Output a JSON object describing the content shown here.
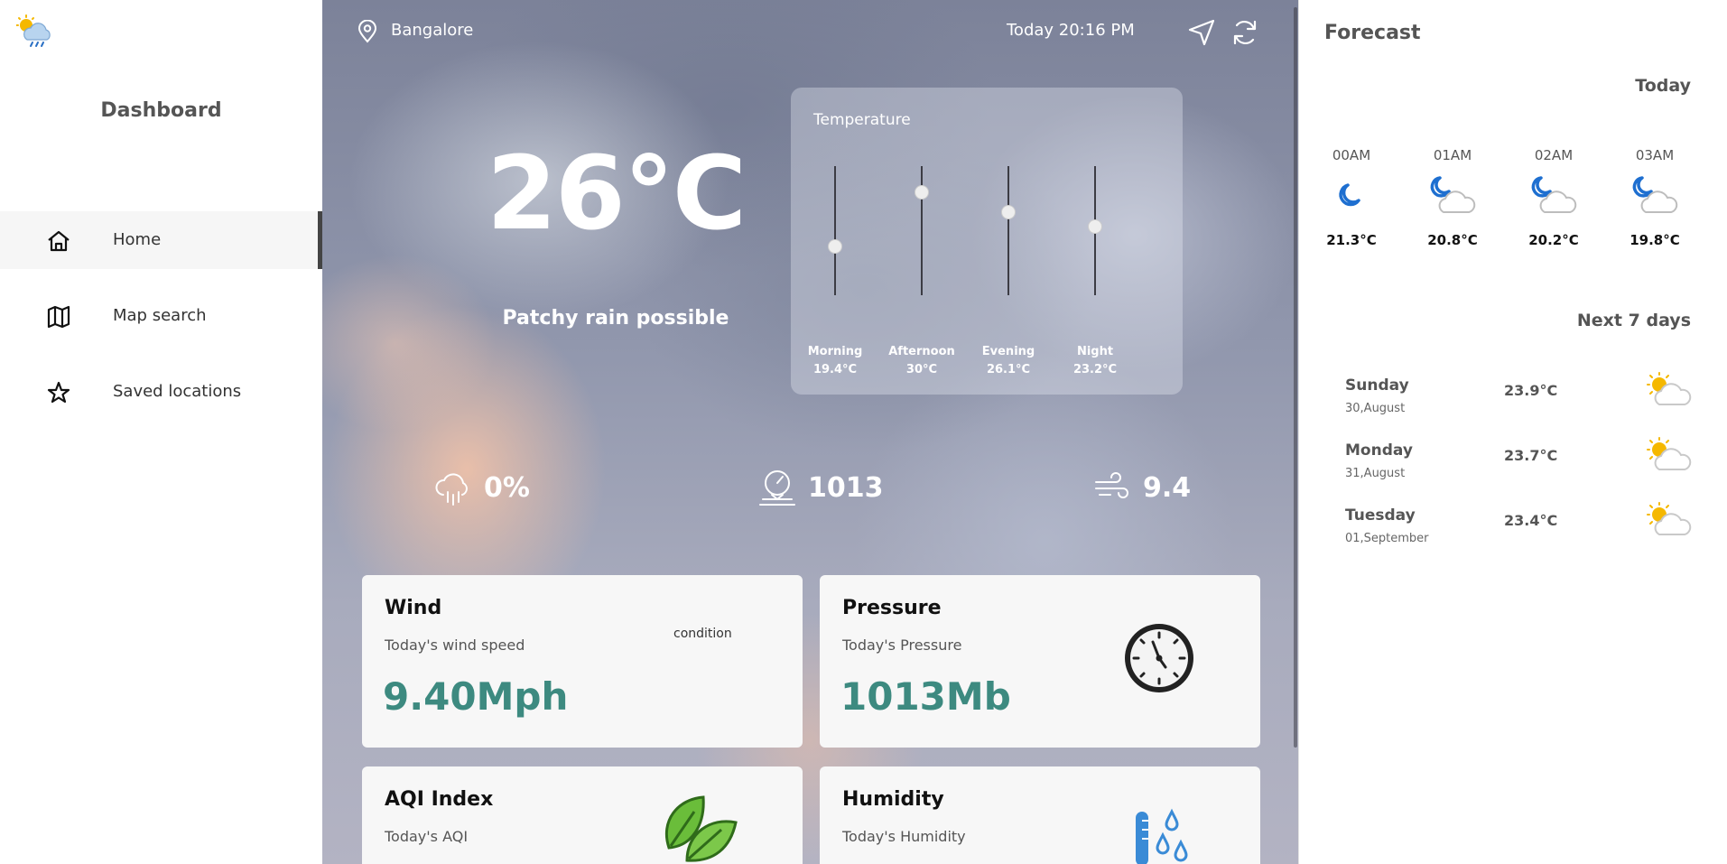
{
  "sidebar": {
    "title": "Dashboard",
    "items": [
      {
        "label": "Home",
        "icon": "home-icon",
        "active": true
      },
      {
        "label": "Map search",
        "icon": "map-icon"
      },
      {
        "label": "Saved locations",
        "icon": "star-icon"
      }
    ]
  },
  "header": {
    "location": "Bangalore",
    "datetime": "Today 20:16 PM"
  },
  "current": {
    "temperature": "26°C",
    "condition": "Patchy rain possible"
  },
  "temperature_panel": {
    "title": "Temperature",
    "slots": [
      {
        "label": "Morning",
        "value": "19.4°C",
        "level": 19.4
      },
      {
        "label": "Afternoon",
        "value": "30°C",
        "level": 30
      },
      {
        "label": "Evening",
        "value": "26.1°C",
        "level": 26.1
      },
      {
        "label": "Night",
        "value": "23.2°C",
        "level": 23.2
      }
    ]
  },
  "stats": {
    "precipitation": "0%",
    "pressure": "1013",
    "wind": "9.4"
  },
  "cards": {
    "wind": {
      "title": "Wind",
      "subtitle": "Today's wind speed",
      "value": "9.40Mph",
      "extra": "condition"
    },
    "pressure": {
      "title": "Pressure",
      "subtitle": "Today's Pressure",
      "value": "1013Mb"
    },
    "aqi": {
      "title": "AQI Index",
      "subtitle": "Today's AQI"
    },
    "humidity": {
      "title": "Humidity",
      "subtitle": "Today's Humidity"
    }
  },
  "forecast": {
    "title": "Forecast",
    "today_label": "Today",
    "hours": [
      {
        "time": "00AM",
        "temp": "21.3°C",
        "icon": "moon-icon"
      },
      {
        "time": "01AM",
        "temp": "20.8°C",
        "icon": "moon-cloud-icon"
      },
      {
        "time": "02AM",
        "temp": "20.2°C",
        "icon": "moon-cloud-icon"
      },
      {
        "time": "03AM",
        "temp": "19.8°C",
        "icon": "moon-cloud-icon"
      }
    ],
    "next_label": "Next 7 days",
    "days": [
      {
        "day": "Sunday",
        "date": "30,August",
        "temp": "23.9°C",
        "icon": "sun-cloud-icon"
      },
      {
        "day": "Monday",
        "date": "31,August",
        "temp": "23.7°C",
        "icon": "sun-cloud-icon"
      },
      {
        "day": "Tuesday",
        "date": "01,September",
        "temp": "23.4°C",
        "icon": "sun-cloud-icon"
      }
    ]
  },
  "colors": {
    "accent_value": "#3d8a80",
    "moon": "#1e6fd0",
    "sun": "#f5b800"
  }
}
